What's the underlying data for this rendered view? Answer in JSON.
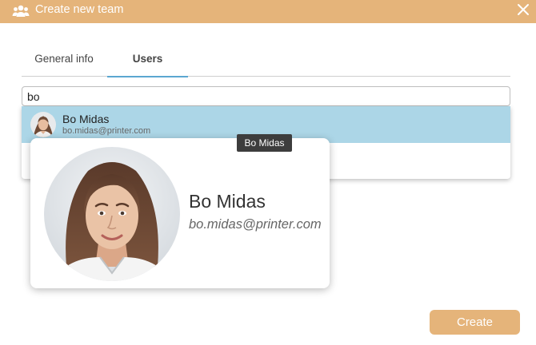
{
  "dialog": {
    "title": "Create new team",
    "title_icon": "team-icon",
    "close_icon": "close-icon",
    "header_color": "#e5b47a"
  },
  "tabs": [
    {
      "label": "General info",
      "active": false
    },
    {
      "label": "Users",
      "active": true
    }
  ],
  "search": {
    "value": "bo"
  },
  "dropdown": {
    "items": [
      {
        "name": "Bo Midas",
        "email": "bo.midas@printer.com",
        "highlighted": true
      }
    ],
    "highlight_color": "#acd6e7"
  },
  "tooltip": {
    "text": "Bo Midas"
  },
  "hover_card": {
    "name": "Bo Midas",
    "email": "bo.midas@printer.com"
  },
  "actions": {
    "create_label": "Create"
  }
}
